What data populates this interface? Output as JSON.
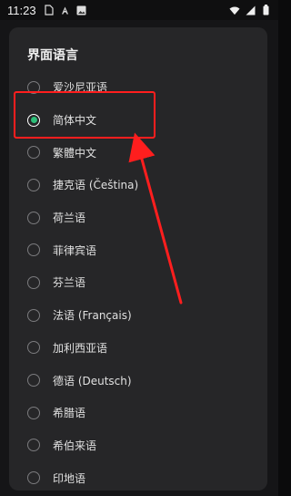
{
  "status_bar": {
    "time": "11:23",
    "left_icons": [
      "sim-icon",
      "notification-a-icon",
      "image-icon"
    ],
    "right_icons": [
      "wifi-icon",
      "signal-icon",
      "battery-icon"
    ]
  },
  "dialog": {
    "title": "界面语言",
    "selected_index": 1,
    "options": [
      {
        "label": "爱沙尼亚语",
        "checked": false
      },
      {
        "label": "简体中文",
        "checked": true
      },
      {
        "label": "繁體中文",
        "checked": false
      },
      {
        "label": "捷克语 (Čeština)",
        "checked": false
      },
      {
        "label": "荷兰语",
        "checked": false
      },
      {
        "label": "菲律宾语",
        "checked": false
      },
      {
        "label": "芬兰语",
        "checked": false
      },
      {
        "label": "法语 (Français)",
        "checked": false
      },
      {
        "label": "加利西亚语",
        "checked": false
      },
      {
        "label": "德语 (Deutsch)",
        "checked": false
      },
      {
        "label": "希腊语",
        "checked": false
      },
      {
        "label": "希伯来语",
        "checked": false
      },
      {
        "label": "印地语",
        "checked": false
      }
    ]
  },
  "annotation": {
    "highlight_color": "#ff1e1e",
    "arrow_color": "#ff1e1e"
  },
  "colors": {
    "accent": "#2ec07a",
    "dialog_bg": "#262628",
    "page_bg": "#0b0b0c"
  }
}
